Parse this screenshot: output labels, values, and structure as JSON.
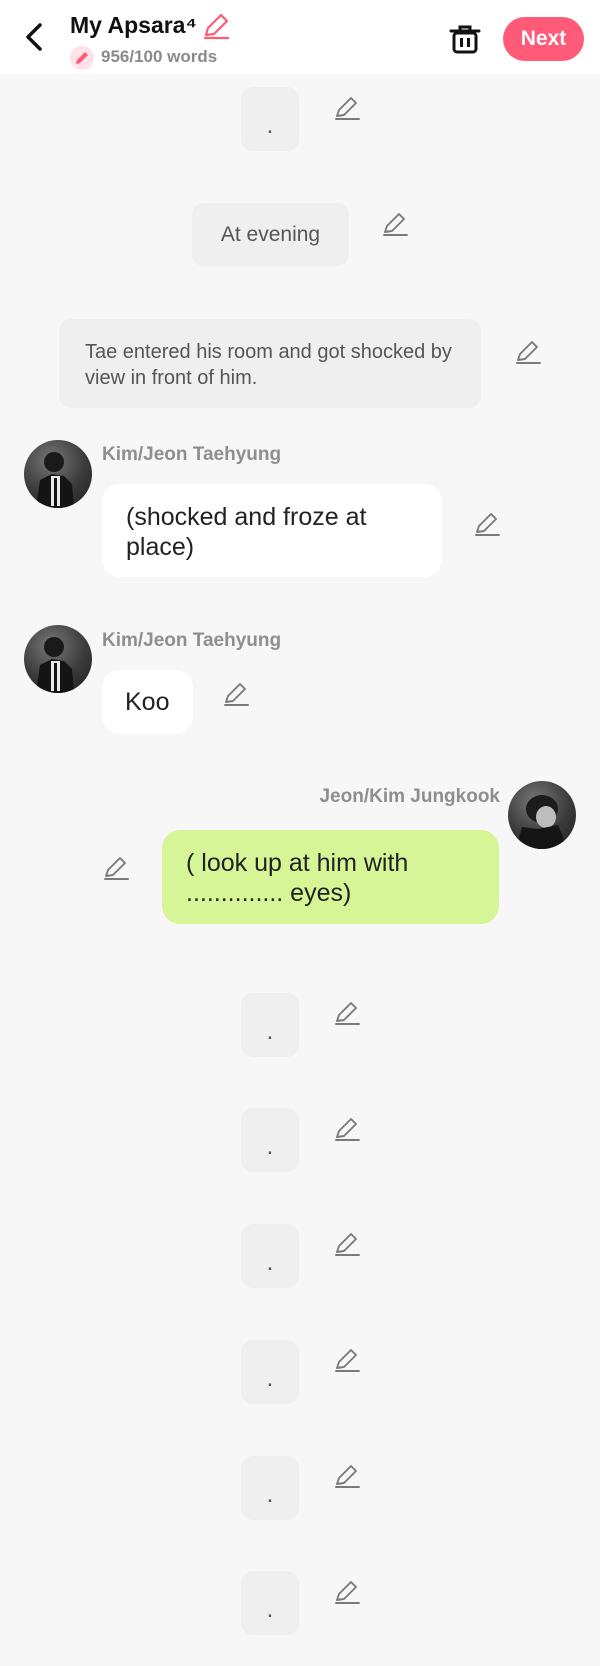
{
  "header": {
    "title": "My Apsara⁴",
    "word_count": "956/100 words",
    "next_label": "Next"
  },
  "messages": {
    "m1": ".",
    "m2": "At evening",
    "m3": "Tae entered his room and got shocked by view in front of him.",
    "m4_speaker": "Kim/Jeon Taehyung",
    "m4_text": "(shocked and froze at place)",
    "m5_speaker": "Kim/Jeon Taehyung",
    "m5_text": "Koo",
    "m6_speaker": "Jeon/Kim Jungkook",
    "m6_text": "( look up at him with .............. eyes)",
    "m7": ".",
    "m8": ".",
    "m9": ".",
    "m10": ".",
    "m11": ".",
    "m12": "."
  },
  "icons": {
    "back": "chevron-left-icon",
    "title_edit": "pencil-icon",
    "word_badge": "pencil-icon",
    "delete": "trash-icon",
    "edit": "pencil-icon"
  },
  "colors": {
    "accent": "#ff5a78",
    "header_bg": "#ffffff",
    "page_bg": "#f7f7f7",
    "narration_bg": "#efefef",
    "bubble_left": "#ffffff",
    "bubble_right": "#d6f596",
    "speaker_text": "#8e8e8e"
  }
}
